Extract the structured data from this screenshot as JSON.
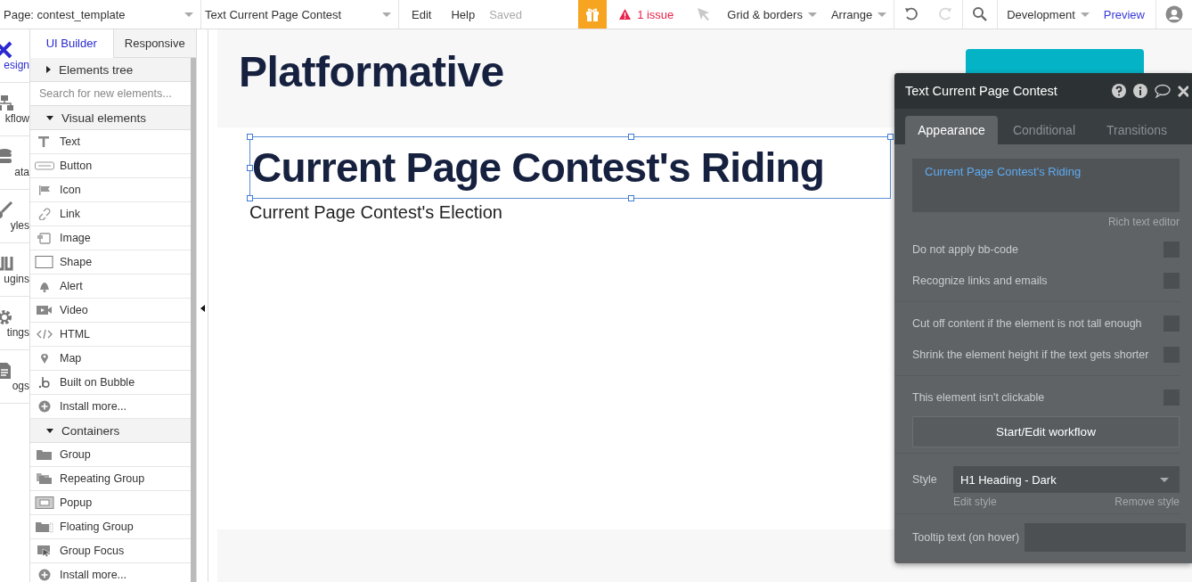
{
  "topbar": {
    "page_select": "Page: contest_template",
    "element_select": "Text Current Page Contest",
    "menus": [
      "Edit",
      "Help"
    ],
    "save_status": "Saved",
    "issues": "1 issue",
    "view_menus": [
      "Grid & borders",
      "Arrange"
    ],
    "version": "Development",
    "preview": "Preview"
  },
  "nav": [
    {
      "label": "esign",
      "selected": true
    },
    {
      "label": "kflow",
      "selected": false
    },
    {
      "label": "ata",
      "selected": false
    },
    {
      "label": "yles",
      "selected": false
    },
    {
      "label": "ugins",
      "selected": false
    },
    {
      "label": "tings",
      "selected": false
    },
    {
      "label": "ogs",
      "selected": false
    }
  ],
  "panel": {
    "tabs": [
      {
        "label": "UI Builder",
        "selected": true
      },
      {
        "label": "Responsive",
        "selected": false
      }
    ],
    "tree": {
      "label": "Elements tree",
      "expanded": false
    },
    "search": {
      "placeholder": "Search for new elements..."
    },
    "sections": [
      {
        "label": "Visual elements",
        "expanded": true,
        "items": [
          "Text",
          "Button",
          "Icon",
          "Link",
          "Image",
          "Shape",
          "Alert",
          "Video",
          "HTML",
          "Map",
          "Built on Bubble",
          "Install more..."
        ]
      },
      {
        "label": "Containers",
        "expanded": true,
        "items": [
          "Group",
          "Repeating Group",
          "Popup",
          "Floating Group",
          "Group Focus",
          "Install more..."
        ]
      }
    ]
  },
  "canvas": {
    "header_title": "Platformative",
    "heading": "Current Page Contest's Riding",
    "subheading": "Current Page Contest's Election"
  },
  "inspector": {
    "title": "Text Current Page Contest",
    "tabs": [
      {
        "label": "Appearance",
        "selected": true
      },
      {
        "label": "Conditional",
        "selected": false
      },
      {
        "label": "Transitions",
        "selected": false
      }
    ],
    "content": "Current Page Contest's Riding",
    "rich_text_link": "Rich text editor",
    "option_groups": [
      {
        "options": [
          {
            "label": "Do not apply bb-code",
            "checked": false
          },
          {
            "label": "Recognize links and emails",
            "checked": false
          }
        ]
      },
      {
        "options": [
          {
            "label": "Cut off content if the element is not tall enough",
            "checked": false
          },
          {
            "label": "Shrink the element height if the text gets shorter",
            "checked": false
          }
        ]
      },
      {
        "options": [
          {
            "label": "This element isn't clickable",
            "checked": false
          }
        ]
      }
    ],
    "workflow_button": "Start/Edit workflow",
    "style": {
      "label": "Style",
      "value": "H1 Heading - Dark",
      "edit": "Edit style",
      "remove": "Remove style"
    },
    "tooltip": {
      "label": "Tooltip text (on hover)"
    }
  }
}
